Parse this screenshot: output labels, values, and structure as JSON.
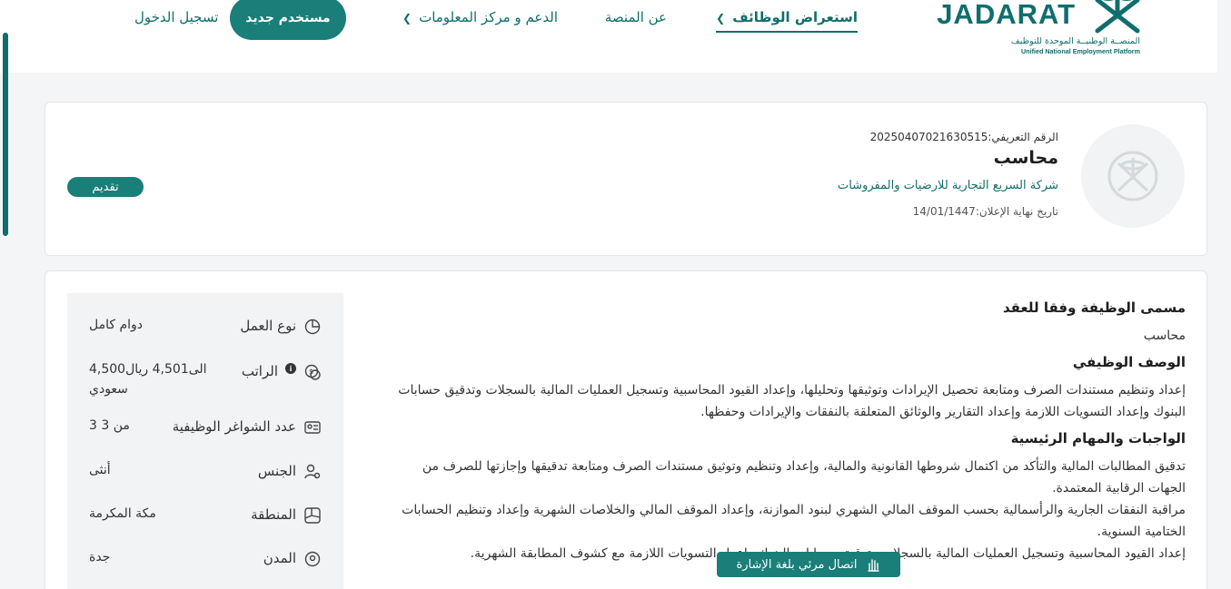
{
  "header": {
    "logo_word": "JADARAT",
    "logo_subtitle_ar": "المنصــة الوطنيــة الموحدة للتوظيف",
    "logo_subtitle_en": "Unified National Employment Platform",
    "nav": {
      "browse_jobs": "استعراض الوظائف",
      "about": "عن المنصة",
      "support": "الدعم و مركز المعلومات"
    },
    "new_user": "مستخدم جديد",
    "login": "تسجيل الدخول"
  },
  "job": {
    "id_text": "الرقم التعريفي:20250407021630515",
    "title": "محاسب",
    "company": "شركة السريع التجارية للارضيات والمفروشات",
    "end_date": "تاريخ نهاية الإعلان:14/01/1447",
    "apply_label": "تقديم"
  },
  "details": [
    {
      "icon": "pie-chart-icon",
      "label": "نوع العمل",
      "value": "دوام كامل"
    },
    {
      "icon": "salary-icon",
      "label": "الراتب",
      "value": "4,500الى4,501 ريال سعودي"
    },
    {
      "icon": "id-card-icon",
      "label": "عدد الشواغر الوظيفية",
      "value": "3 من 3"
    },
    {
      "icon": "gender-icon",
      "label": "الجنس",
      "value": "أنثى"
    },
    {
      "icon": "map-icon",
      "label": "المنطقة",
      "value": "مكة المكرمة"
    },
    {
      "icon": "location-pin-icon",
      "label": "المدن",
      "value": "جدة"
    }
  ],
  "description": {
    "contract_title_heading": "مسمى الوظيفة وفقا للعقد",
    "contract_title_value": "محاسب",
    "job_desc_heading": "الوصف الوظيفي",
    "job_desc_text": "إعداد وتنظيم مستندات الصرف ومتابعة تحصيل الإيرادات وتوثيقها وتحليلها، وإعداد القيود المحاسبية وتسجيل العمليات المالية بالسجلات وتدقيق حسابات البنوك وإعداد التسويات اللازمة وإعداد التقارير والوثائق المتعلقة بالنفقات والإيرادات وحفظها.",
    "duties_heading": "الواجبات والمهام الرئيسية",
    "duty_1": "تدقيق المطالبات المالية والتأكد من اكتمال شروطها القانونية والمالية، وإعداد وتنظيم وتوثيق مستندات الصرف ومتابعة تدقيقها وإجازتها للصرف من الجهات الرقابية المعتمدة.",
    "duty_2": "مراقبة النفقات الجارية والرأسمالية بحسب الموقف المالي الشهري لبنود الموازنة، وإعداد الموقف المالي والخلاصات الشهرية وإعداد وتنظيم الحسابات الختامية السنوية.",
    "duty_3": "إعداد القيود المحاسبية وتسجيل العمليات المالية بالسجلات وتدقيق حسابات البنوك وإعداد التسويات اللازمة مع كشوف المطابقة الشهرية."
  },
  "sign_language_button": "اتصال مرئي بلغة الإشارة"
}
